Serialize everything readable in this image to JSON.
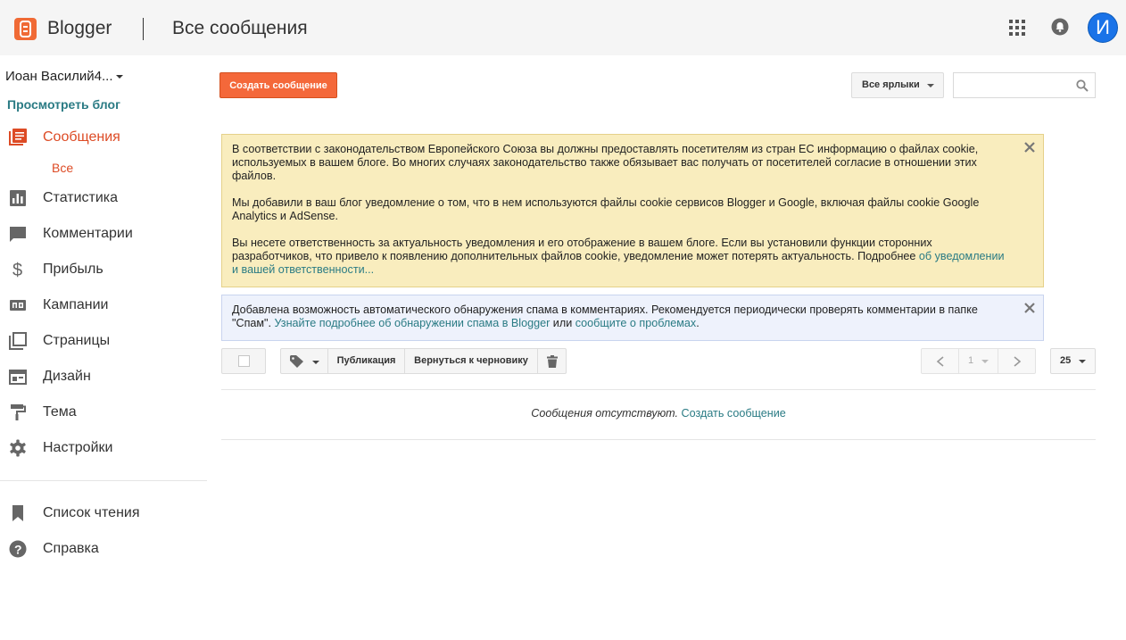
{
  "header": {
    "brand": "Blogger",
    "page_title": "Все сообщения",
    "avatar_letter": "И",
    "accent_color": "#f06a35"
  },
  "sidebar": {
    "blog_name": "Иоан  Василий4...",
    "view_blog": "Просмотреть блог",
    "items": [
      {
        "label": "Сообщения",
        "icon": "posts-icon",
        "active": true
      },
      {
        "label": "Статистика",
        "icon": "stats-icon"
      },
      {
        "label": "Комментарии",
        "icon": "comments-icon"
      },
      {
        "label": "Прибыль",
        "icon": "dollar-icon"
      },
      {
        "label": "Кампании",
        "icon": "ad-campaign-icon"
      },
      {
        "label": "Страницы",
        "icon": "pages-icon"
      },
      {
        "label": "Дизайн",
        "icon": "layout-icon"
      },
      {
        "label": "Тема",
        "icon": "paint-roller-icon"
      },
      {
        "label": "Настройки",
        "icon": "gear-icon"
      }
    ],
    "sub_item": "Все",
    "bottom_items": [
      {
        "label": "Список чтения",
        "icon": "bookmark-icon"
      },
      {
        "label": "Справка",
        "icon": "help-icon"
      }
    ]
  },
  "main": {
    "create_post": "Создать сообщение",
    "labels_filter": "Все ярлыки",
    "search_placeholder": "",
    "cookie_notice": {
      "p1": "В соответствии с законодательством Европейского Союза вы должны предоставлять посетителям из стран ЕС информацию о файлах cookie, используемых в вашем блоге. Во многих случаях законодательство также обязывает вас получать от посетителей согласие в отношении этих файлов.",
      "p2": "Мы добавили в ваш блог уведомление о том, что в нем используются файлы cookie сервисов Blogger и Google, включая файлы cookie Google Analytics и AdSense.",
      "p3": "Вы несете ответственность за актуальность уведомления и его отображение в вашем блоге. Если вы установили функции сторонних разработчиков, что привело к появлению дополнительных файлов cookie, уведомление может потерять актуальность. Подробнее ",
      "p3_link": "об уведомлении и вашей ответственности..."
    },
    "spam_notice": {
      "text": "Добавлена возможность автоматического обнаружения спама в комментариях. Рекомендуется периодически проверять комментарии в папке \"Спам\". ",
      "link1": "Узнайте подробнее об обнаружении спама в Blogger",
      "mid": " или ",
      "link2": "сообщите о проблемах",
      "end": "."
    },
    "toolbar": {
      "publish": "Публикация",
      "revert_draft": "Вернуться к черновику",
      "page": "1",
      "per_page": "25"
    },
    "empty": {
      "text": "Сообщения отсутствуют. ",
      "link": "Создать сообщение"
    }
  }
}
